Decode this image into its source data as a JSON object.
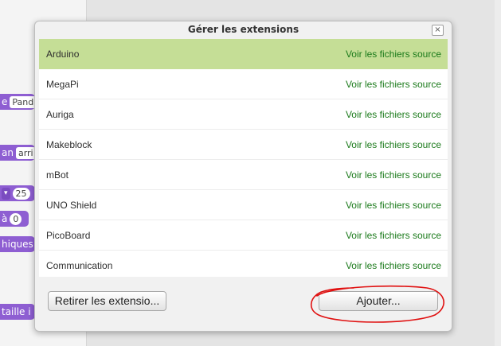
{
  "background": {
    "blocks": [
      {
        "prefix": "e",
        "slot": "Panda",
        "kind": "slot"
      },
      {
        "prefix": "an",
        "slot": "arri",
        "kind": "slot"
      },
      {
        "prefix": "",
        "dropdown": "▾",
        "slot": "25",
        "kind": "round"
      },
      {
        "prefix": "à",
        "slot": "0",
        "kind": "round"
      },
      {
        "prefix": "hiques",
        "slot": "",
        "kind": "none"
      },
      {
        "prefix": "taille i",
        "slot": "",
        "kind": "none"
      }
    ]
  },
  "dialog": {
    "title": "Gérer les extensions",
    "close_label": "×",
    "extensions": [
      {
        "name": "Arduino",
        "link": "Voir les fichiers source",
        "selected": true
      },
      {
        "name": "MegaPi",
        "link": "Voir les fichiers source",
        "selected": false
      },
      {
        "name": "Auriga",
        "link": "Voir les fichiers source",
        "selected": false
      },
      {
        "name": "Makeblock",
        "link": "Voir les fichiers source",
        "selected": false
      },
      {
        "name": "mBot",
        "link": "Voir les fichiers source",
        "selected": false
      },
      {
        "name": "UNO Shield",
        "link": "Voir les fichiers source",
        "selected": false
      },
      {
        "name": "PicoBoard",
        "link": "Voir les fichiers source",
        "selected": false
      },
      {
        "name": "Communication",
        "link": "Voir les fichiers source",
        "selected": false
      }
    ],
    "remove_button": "Retirer les extensio...",
    "add_button": "Ajouter..."
  },
  "colors": {
    "selected_row": "#c5de96",
    "link": "#1a7a1a",
    "block": "#8e5ed2",
    "annotation": "#e01010"
  }
}
